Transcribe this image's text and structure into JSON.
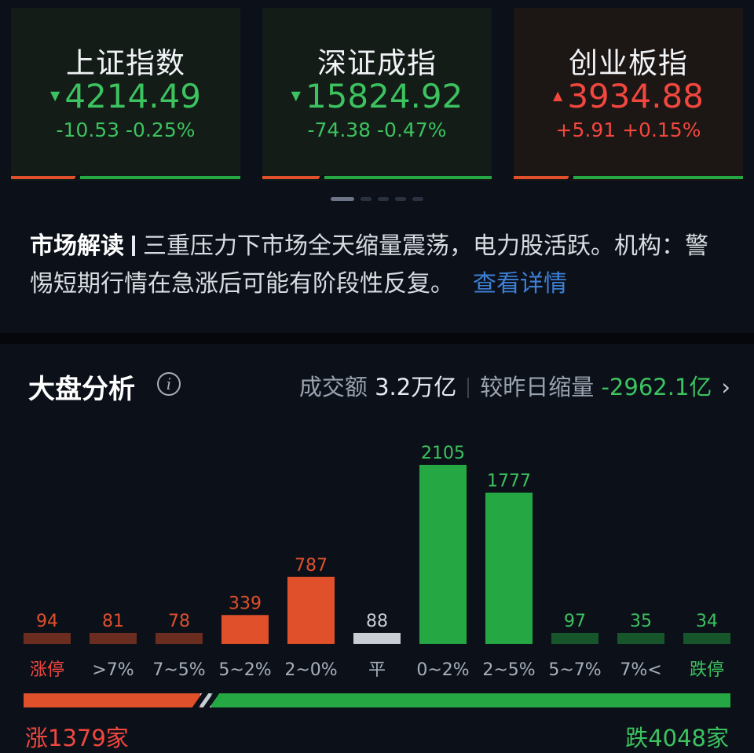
{
  "indices": [
    {
      "name": "上证指数",
      "price": "4214.49",
      "change": "-10.53  -0.25%",
      "direction": "down",
      "arrow": "▼"
    },
    {
      "name": "深证成指",
      "price": "15824.92",
      "change": "-74.38  -0.47%",
      "direction": "down",
      "arrow": "▼"
    },
    {
      "name": "创业板指",
      "price": "3934.88",
      "change": "+5.91  +0.15%",
      "direction": "up",
      "arrow": "▲"
    }
  ],
  "commentary": {
    "tag": "市场解读",
    "text": "三重压力下市场全天缩量震荡，电力股活跃。机构：警惕短期行情在急涨后可能有阶段性反复。",
    "link": "查看详情"
  },
  "analysis": {
    "title": "大盘分析",
    "turnover_label": "成交额",
    "turnover_value": "3.2万亿",
    "compare_label": "较昨日缩量",
    "compare_value": "-2962.1亿",
    "rise_label": "涨1379家",
    "fall_label": "跌4048家"
  },
  "colors": {
    "up": "#e0502a",
    "up_text": "#f2473f",
    "down": "#25a843",
    "down_text": "#3cc25f",
    "flat": "#c9cdd4"
  },
  "chart_data": {
    "type": "bar",
    "categories": [
      "涨停",
      ">7%",
      "7~5%",
      "5~2%",
      "2~0%",
      "平",
      "0~2%",
      "2~5%",
      "5~7%",
      "7%<",
      "跌停"
    ],
    "values": [
      94,
      81,
      78,
      339,
      787,
      88,
      2105,
      1777,
      97,
      35,
      34
    ],
    "groups": [
      "up",
      "up",
      "up",
      "up",
      "up",
      "flat",
      "down",
      "down",
      "down",
      "down",
      "down"
    ]
  },
  "breadth": {
    "up": 1379,
    "flat": 88,
    "down": 4048
  }
}
